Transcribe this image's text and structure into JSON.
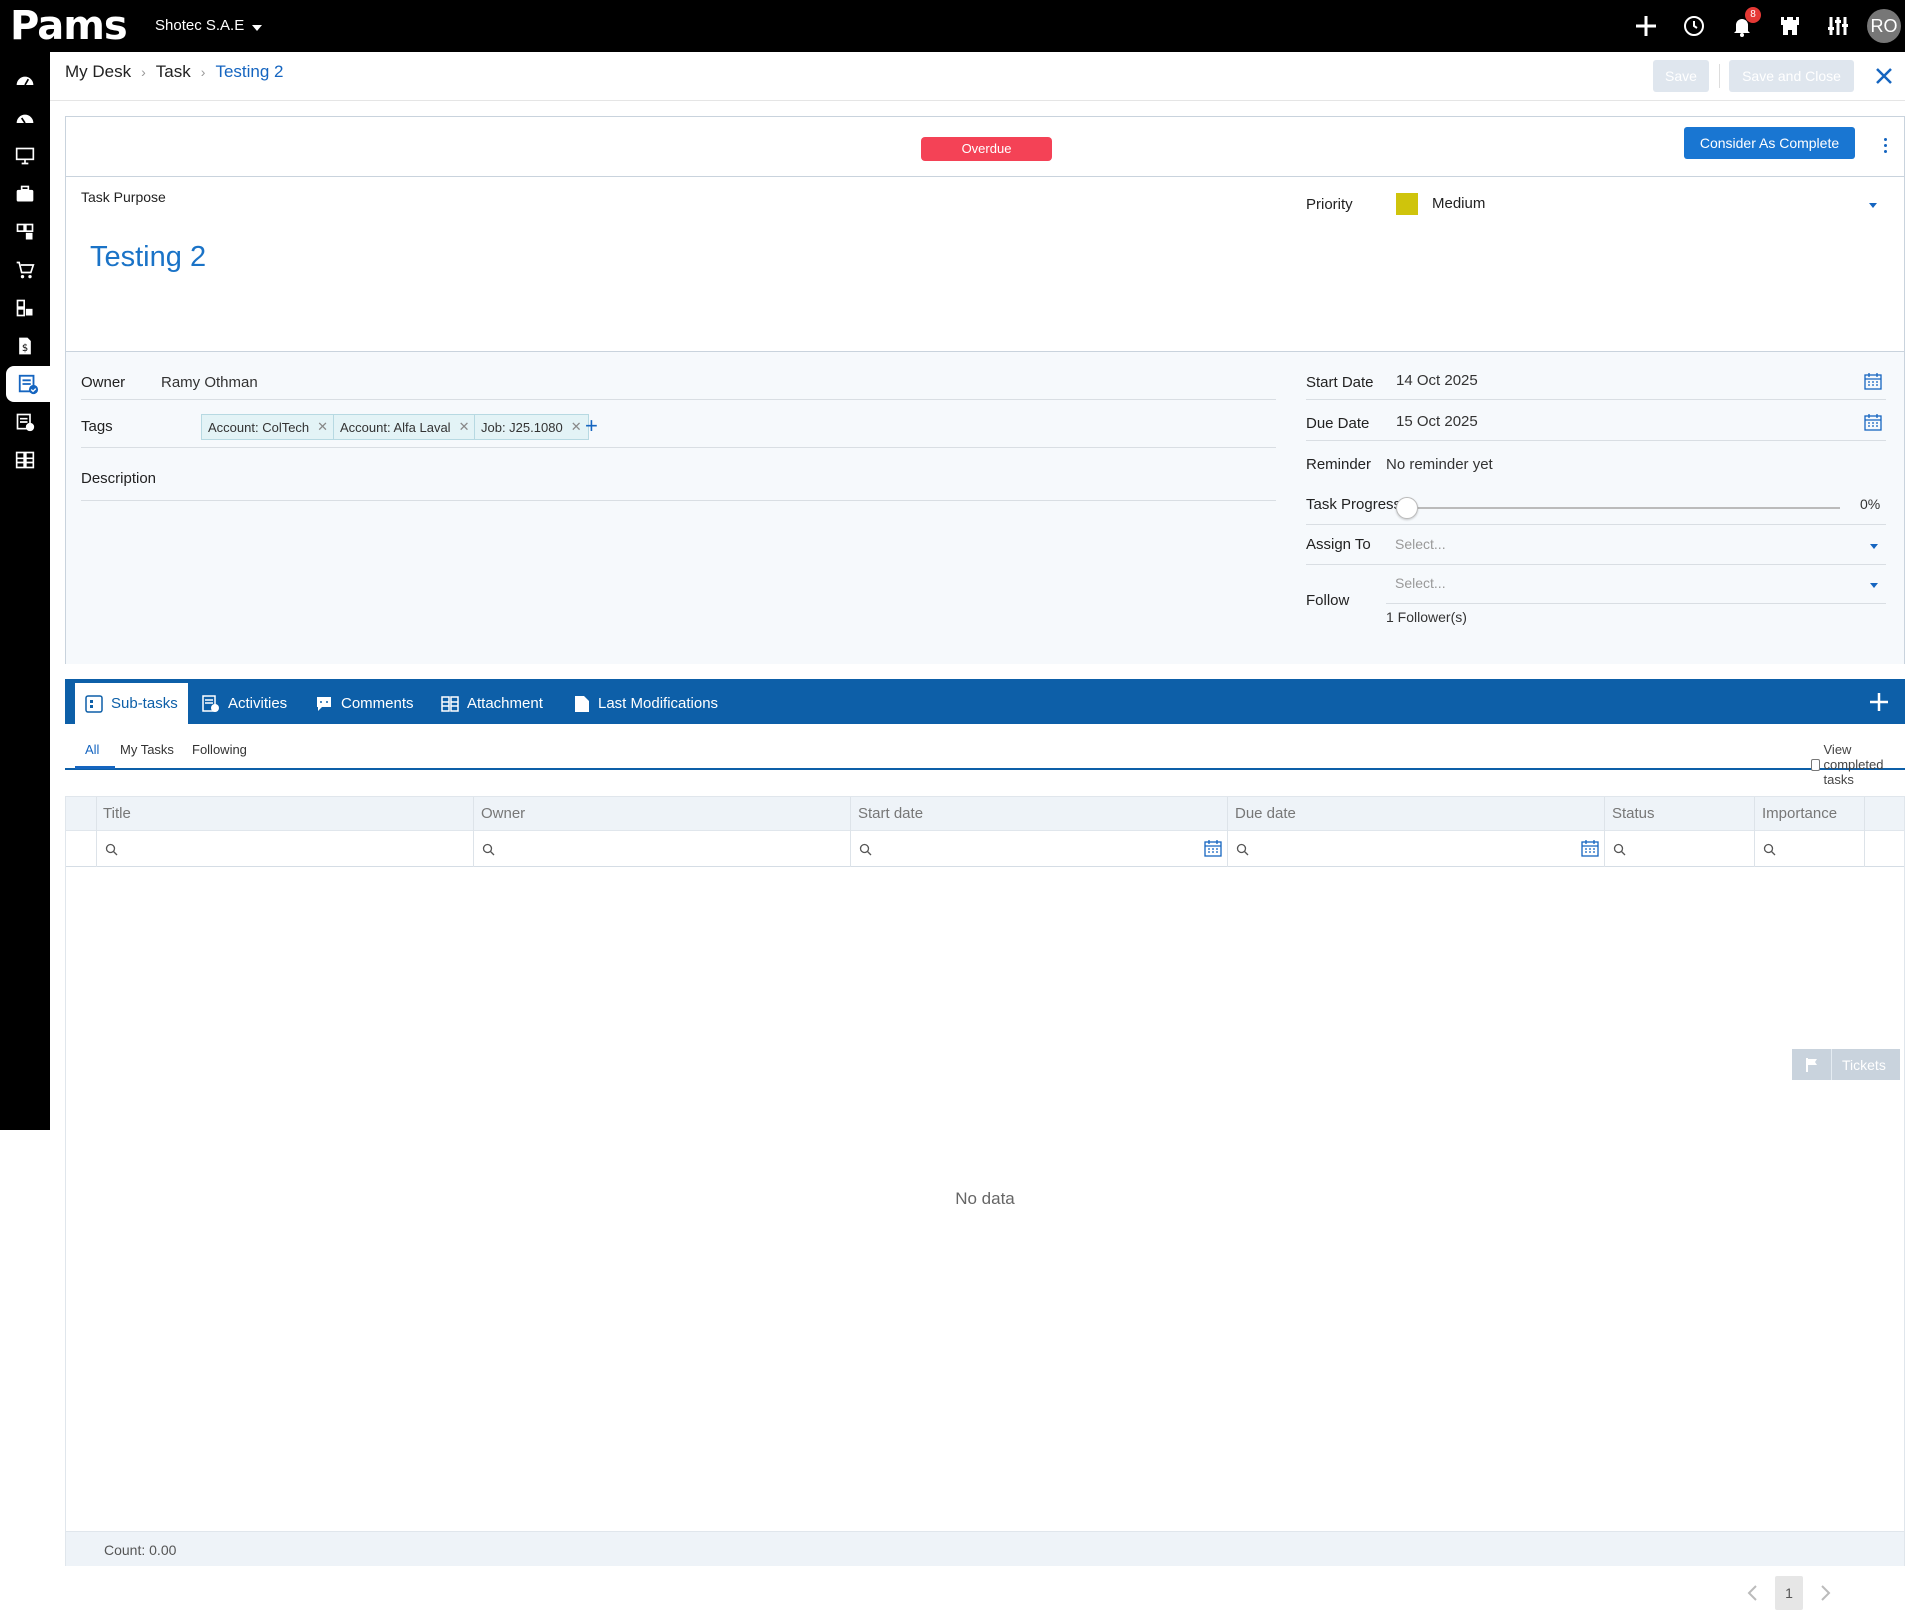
{
  "app": {
    "logo_text": "Pams",
    "company": "Shotec S.A.E",
    "notifications_count": "8",
    "user_initials": "RO"
  },
  "breadcrumb": {
    "root": "My Desk",
    "section": "Task",
    "current": "Testing 2"
  },
  "header": {
    "save_label": "Save",
    "save_close_label": "Save and Close"
  },
  "task": {
    "status_badge": "Overdue",
    "complete_button": "Consider As Complete",
    "purpose_label": "Task Purpose",
    "purpose_value": "Testing 2",
    "priority_label": "Priority",
    "priority_value": "Medium",
    "priority_color": "#cfc40c",
    "owner_label": "Owner",
    "owner_value": "Ramy Othman",
    "tags_label": "Tags",
    "tags": [
      "Account: ColTech",
      "Account: Alfa Laval",
      "Job: J25.1080"
    ],
    "description_label": "Description",
    "start_date_label": "Start Date",
    "start_date_value": "14 Oct 2025",
    "due_date_label": "Due Date",
    "due_date_value": "15 Oct 2025",
    "reminder_label": "Reminder",
    "reminder_value": "No reminder yet",
    "progress_label": "Task Progress",
    "progress_value": "0%",
    "assign_label": "Assign To",
    "assign_placeholder": "Select...",
    "follow_label": "Follow",
    "follow_placeholder": "Select...",
    "followers_text": "1 Follower(s)"
  },
  "tabs": [
    "Sub-tasks",
    "Activities",
    "Comments",
    "Attachment",
    "Last Modifications"
  ],
  "subtabs": {
    "all": "All",
    "my": "My Tasks",
    "following": "Following",
    "view_completed": "View completed tasks"
  },
  "grid": {
    "columns": [
      "Title",
      "Owner",
      "Start date",
      "Due date",
      "Status",
      "Importance"
    ],
    "empty_text": "No data",
    "count_text": "Count: 0.00"
  },
  "tickets_label": "Tickets",
  "pager": {
    "page": "1"
  },
  "colors": {
    "accent": "#0d5fa8",
    "button": "#1976d2",
    "overdue": "#f44256",
    "link": "#1a73c7"
  }
}
